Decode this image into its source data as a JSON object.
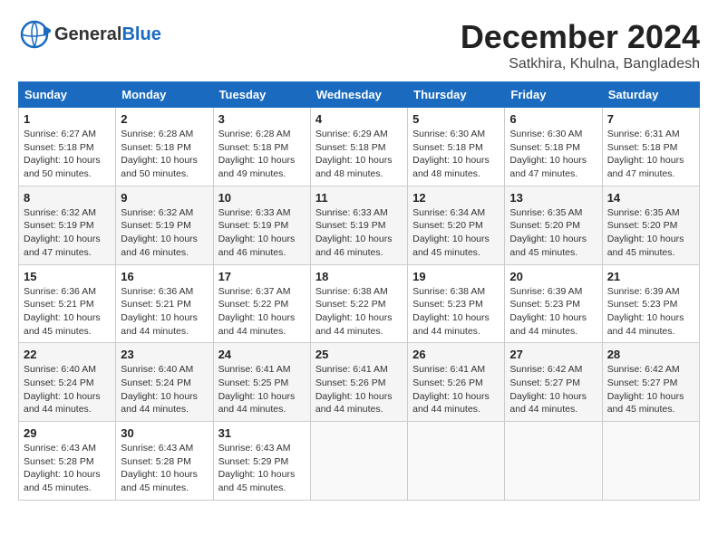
{
  "header": {
    "logo_general": "General",
    "logo_blue": "Blue",
    "title": "December 2024",
    "location": "Satkhira, Khulna, Bangladesh"
  },
  "weekdays": [
    "Sunday",
    "Monday",
    "Tuesday",
    "Wednesday",
    "Thursday",
    "Friday",
    "Saturday"
  ],
  "weeks": [
    [
      {
        "day": "1",
        "info": "Sunrise: 6:27 AM\nSunset: 5:18 PM\nDaylight: 10 hours\nand 50 minutes."
      },
      {
        "day": "2",
        "info": "Sunrise: 6:28 AM\nSunset: 5:18 PM\nDaylight: 10 hours\nand 50 minutes."
      },
      {
        "day": "3",
        "info": "Sunrise: 6:28 AM\nSunset: 5:18 PM\nDaylight: 10 hours\nand 49 minutes."
      },
      {
        "day": "4",
        "info": "Sunrise: 6:29 AM\nSunset: 5:18 PM\nDaylight: 10 hours\nand 48 minutes."
      },
      {
        "day": "5",
        "info": "Sunrise: 6:30 AM\nSunset: 5:18 PM\nDaylight: 10 hours\nand 48 minutes."
      },
      {
        "day": "6",
        "info": "Sunrise: 6:30 AM\nSunset: 5:18 PM\nDaylight: 10 hours\nand 47 minutes."
      },
      {
        "day": "7",
        "info": "Sunrise: 6:31 AM\nSunset: 5:18 PM\nDaylight: 10 hours\nand 47 minutes."
      }
    ],
    [
      {
        "day": "8",
        "info": "Sunrise: 6:32 AM\nSunset: 5:19 PM\nDaylight: 10 hours\nand 47 minutes."
      },
      {
        "day": "9",
        "info": "Sunrise: 6:32 AM\nSunset: 5:19 PM\nDaylight: 10 hours\nand 46 minutes."
      },
      {
        "day": "10",
        "info": "Sunrise: 6:33 AM\nSunset: 5:19 PM\nDaylight: 10 hours\nand 46 minutes."
      },
      {
        "day": "11",
        "info": "Sunrise: 6:33 AM\nSunset: 5:19 PM\nDaylight: 10 hours\nand 46 minutes."
      },
      {
        "day": "12",
        "info": "Sunrise: 6:34 AM\nSunset: 5:20 PM\nDaylight: 10 hours\nand 45 minutes."
      },
      {
        "day": "13",
        "info": "Sunrise: 6:35 AM\nSunset: 5:20 PM\nDaylight: 10 hours\nand 45 minutes."
      },
      {
        "day": "14",
        "info": "Sunrise: 6:35 AM\nSunset: 5:20 PM\nDaylight: 10 hours\nand 45 minutes."
      }
    ],
    [
      {
        "day": "15",
        "info": "Sunrise: 6:36 AM\nSunset: 5:21 PM\nDaylight: 10 hours\nand 45 minutes."
      },
      {
        "day": "16",
        "info": "Sunrise: 6:36 AM\nSunset: 5:21 PM\nDaylight: 10 hours\nand 44 minutes."
      },
      {
        "day": "17",
        "info": "Sunrise: 6:37 AM\nSunset: 5:22 PM\nDaylight: 10 hours\nand 44 minutes."
      },
      {
        "day": "18",
        "info": "Sunrise: 6:38 AM\nSunset: 5:22 PM\nDaylight: 10 hours\nand 44 minutes."
      },
      {
        "day": "19",
        "info": "Sunrise: 6:38 AM\nSunset: 5:23 PM\nDaylight: 10 hours\nand 44 minutes."
      },
      {
        "day": "20",
        "info": "Sunrise: 6:39 AM\nSunset: 5:23 PM\nDaylight: 10 hours\nand 44 minutes."
      },
      {
        "day": "21",
        "info": "Sunrise: 6:39 AM\nSunset: 5:23 PM\nDaylight: 10 hours\nand 44 minutes."
      }
    ],
    [
      {
        "day": "22",
        "info": "Sunrise: 6:40 AM\nSunset: 5:24 PM\nDaylight: 10 hours\nand 44 minutes."
      },
      {
        "day": "23",
        "info": "Sunrise: 6:40 AM\nSunset: 5:24 PM\nDaylight: 10 hours\nand 44 minutes."
      },
      {
        "day": "24",
        "info": "Sunrise: 6:41 AM\nSunset: 5:25 PM\nDaylight: 10 hours\nand 44 minutes."
      },
      {
        "day": "25",
        "info": "Sunrise: 6:41 AM\nSunset: 5:26 PM\nDaylight: 10 hours\nand 44 minutes."
      },
      {
        "day": "26",
        "info": "Sunrise: 6:41 AM\nSunset: 5:26 PM\nDaylight: 10 hours\nand 44 minutes."
      },
      {
        "day": "27",
        "info": "Sunrise: 6:42 AM\nSunset: 5:27 PM\nDaylight: 10 hours\nand 44 minutes."
      },
      {
        "day": "28",
        "info": "Sunrise: 6:42 AM\nSunset: 5:27 PM\nDaylight: 10 hours\nand 45 minutes."
      }
    ],
    [
      {
        "day": "29",
        "info": "Sunrise: 6:43 AM\nSunset: 5:28 PM\nDaylight: 10 hours\nand 45 minutes."
      },
      {
        "day": "30",
        "info": "Sunrise: 6:43 AM\nSunset: 5:28 PM\nDaylight: 10 hours\nand 45 minutes."
      },
      {
        "day": "31",
        "info": "Sunrise: 6:43 AM\nSunset: 5:29 PM\nDaylight: 10 hours\nand 45 minutes."
      },
      {
        "day": "",
        "info": ""
      },
      {
        "day": "",
        "info": ""
      },
      {
        "day": "",
        "info": ""
      },
      {
        "day": "",
        "info": ""
      }
    ]
  ]
}
